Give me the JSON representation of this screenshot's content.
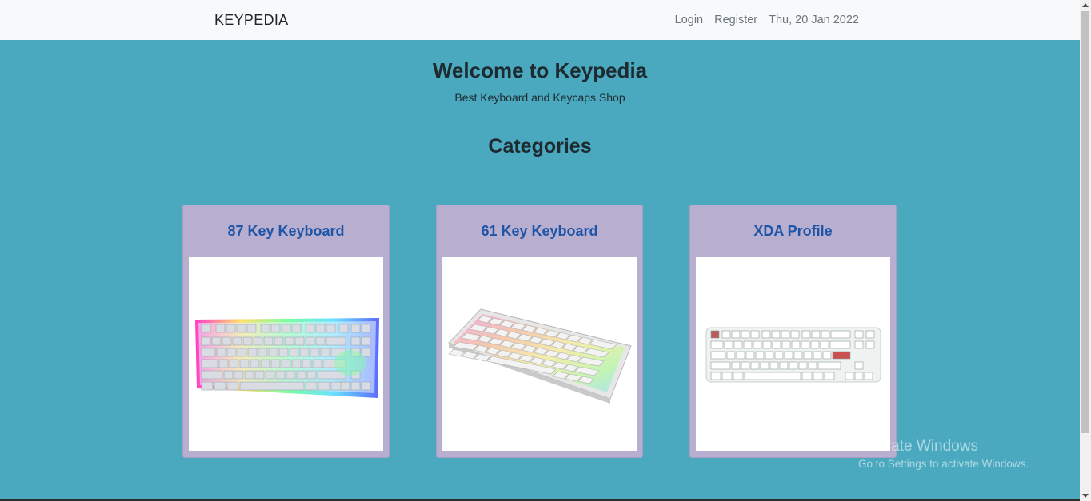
{
  "navbar": {
    "brand": "KEYPEDIA",
    "login": "Login",
    "register": "Register",
    "date": "Thu, 20 Jan 2022"
  },
  "hero": {
    "title": "Welcome to Keypedia",
    "subtitle": "Best Keyboard and Keycaps Shop"
  },
  "categories": {
    "heading": "Categories",
    "items": [
      {
        "label": "87 Key Keyboard",
        "image": "rgb-tkl-keyboard"
      },
      {
        "label": "61 Key Keyboard",
        "image": "rgb-60-percent-keyboard"
      },
      {
        "label": "XDA Profile",
        "image": "xda-keycaps-keyboard"
      }
    ]
  },
  "watermark": {
    "line1": "Activate Windows",
    "line2": "Go to Settings to activate Windows."
  },
  "colors": {
    "background": "#4aa8bf",
    "navbar": "#f8f9fa",
    "card": "#b8aed0",
    "card_title": "#1f55a6"
  }
}
